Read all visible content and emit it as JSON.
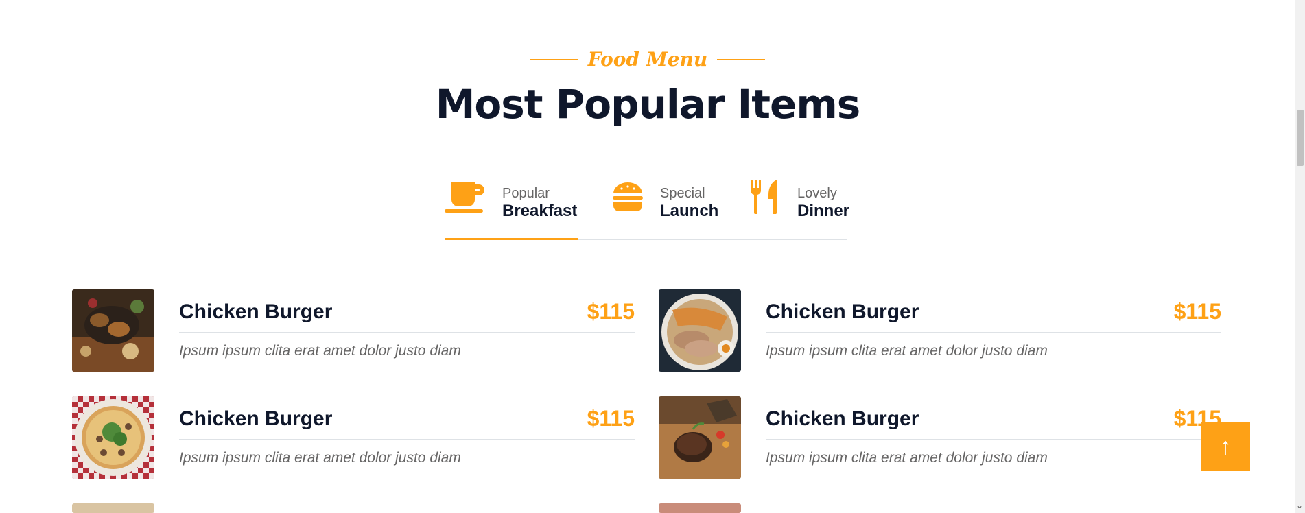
{
  "header": {
    "eyebrow": "Food Menu",
    "title": "Most Popular Items"
  },
  "colors": {
    "accent": "#fea116",
    "dark": "#0f172b",
    "muted": "#666565"
  },
  "tabs": [
    {
      "icon": "coffee-icon",
      "small": "Popular",
      "big": "Breakfast",
      "active": true
    },
    {
      "icon": "hamburger-icon",
      "small": "Special",
      "big": "Launch",
      "active": false
    },
    {
      "icon": "utensils-icon",
      "small": "Lovely",
      "big": "Dinner",
      "active": false
    }
  ],
  "menu": {
    "items": [
      {
        "name": "Chicken Burger",
        "price": "$115",
        "desc": "Ipsum ipsum clita erat amet dolor justo diam"
      },
      {
        "name": "Chicken Burger",
        "price": "$115",
        "desc": "Ipsum ipsum clita erat amet dolor justo diam"
      },
      {
        "name": "Chicken Burger",
        "price": "$115",
        "desc": "Ipsum ipsum clita erat amet dolor justo diam"
      },
      {
        "name": "Chicken Burger",
        "price": "$115",
        "desc": "Ipsum ipsum clita erat amet dolor justo diam"
      }
    ]
  },
  "back_to_top": {
    "icon": "arrow-up-icon",
    "glyph": "↑"
  }
}
